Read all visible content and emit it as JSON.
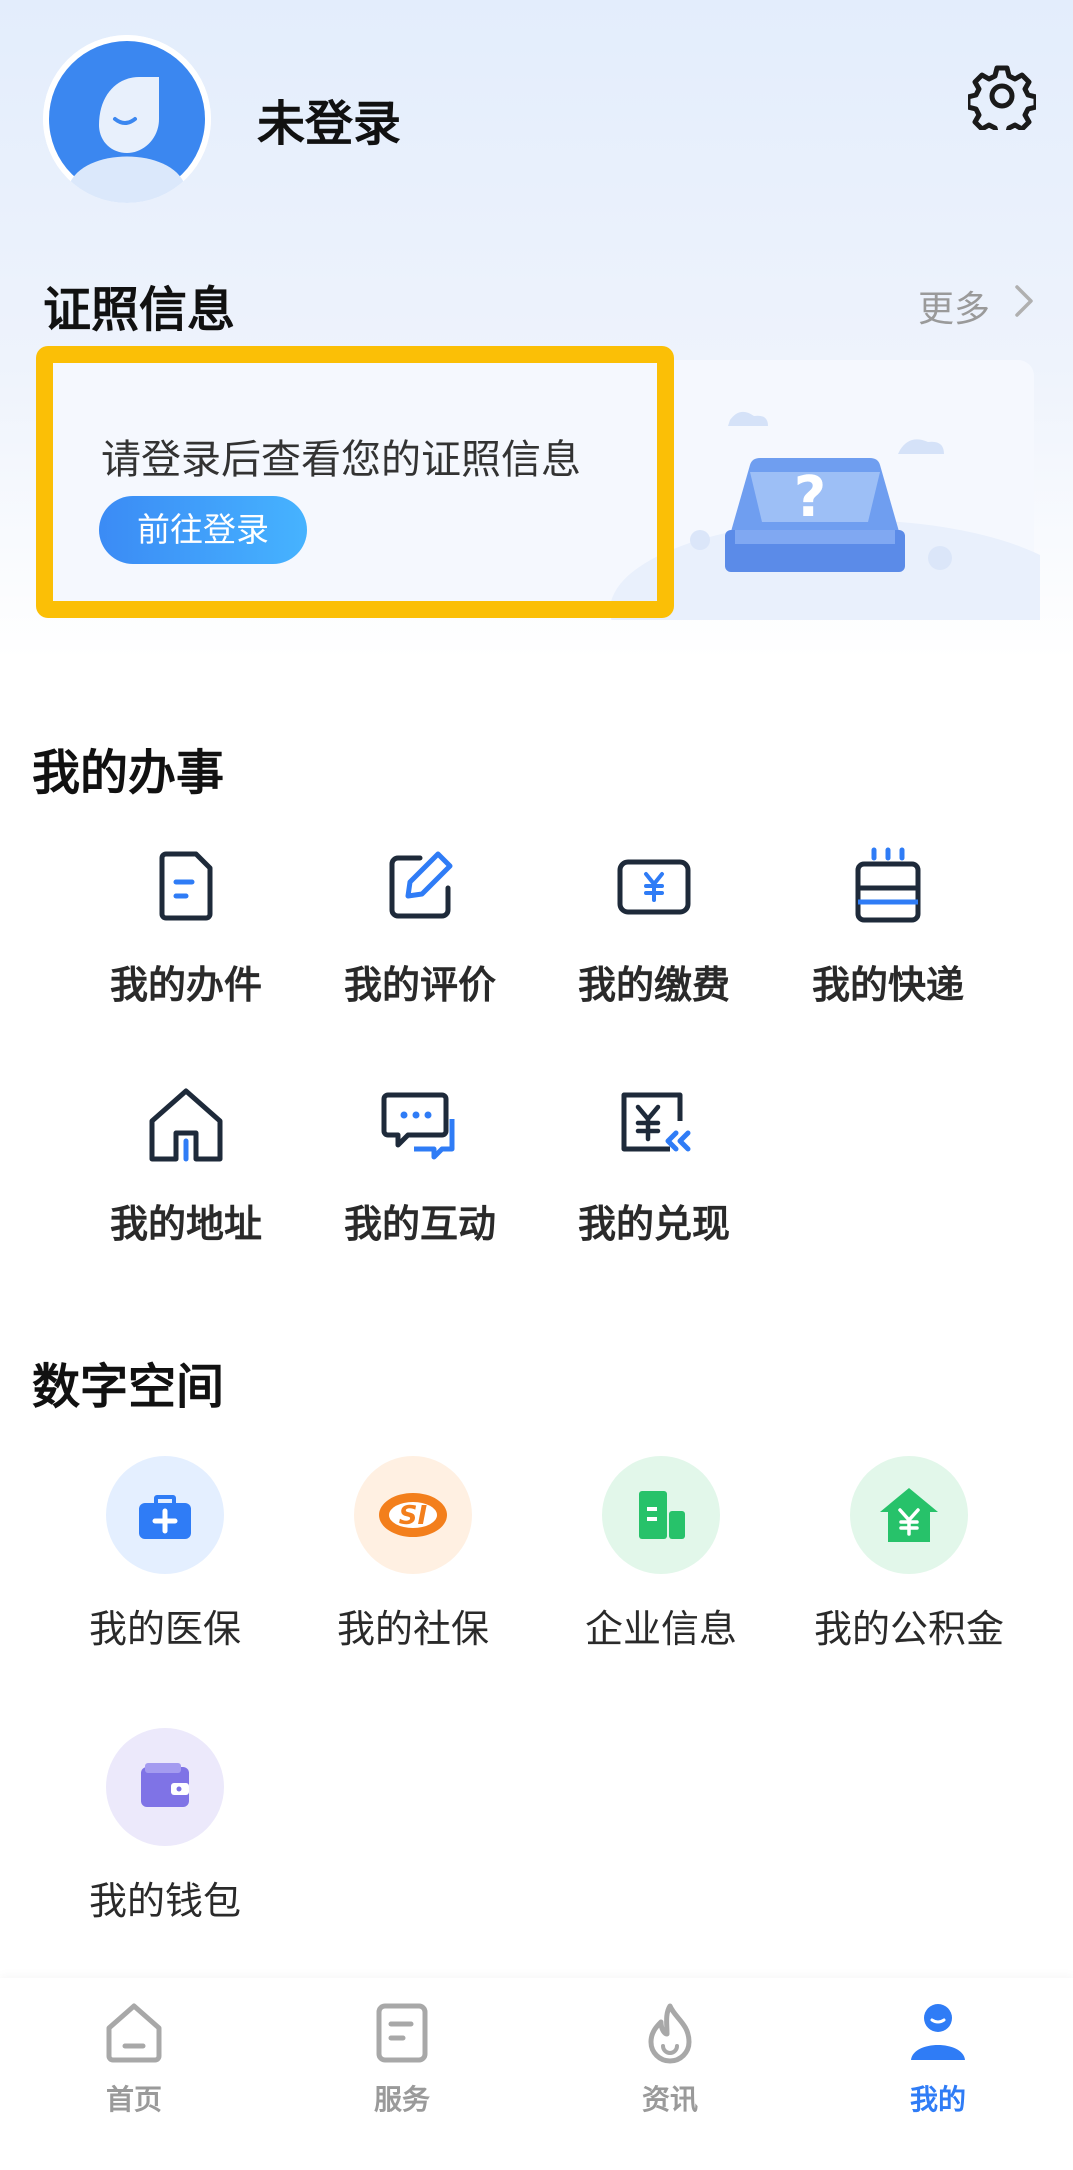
{
  "header": {
    "username": "未登录",
    "avatar_icon": "avatar-placeholder-icon",
    "settings_icon": "gear-icon"
  },
  "certificates": {
    "title": "证照信息",
    "more_label": "更多",
    "hint": "请登录后查看您的证照信息",
    "login_button": "前往登录",
    "highlight_color": "#fbbf06",
    "accent_color": "#3b8bf5"
  },
  "my_affairs": {
    "title": "我的办事",
    "items": [
      {
        "label": "我的办件",
        "icon": "document-icon"
      },
      {
        "label": "我的评价",
        "icon": "edit-icon"
      },
      {
        "label": "我的缴费",
        "icon": "yuan-payment-icon"
      },
      {
        "label": "我的快递",
        "icon": "parcel-icon"
      },
      {
        "label": "我的地址",
        "icon": "home-icon"
      },
      {
        "label": "我的互动",
        "icon": "chat-icon"
      },
      {
        "label": "我的兑现",
        "icon": "redeem-icon"
      }
    ]
  },
  "digital_space": {
    "title": "数字空间",
    "items": [
      {
        "label": "我的医保",
        "icon": "medical-kit-icon"
      },
      {
        "label": "我的社保",
        "icon": "social-security-icon"
      },
      {
        "label": "企业信息",
        "icon": "building-icon"
      },
      {
        "label": "我的公积金",
        "icon": "housing-fund-icon"
      },
      {
        "label": "我的钱包",
        "icon": "wallet-icon"
      }
    ]
  },
  "tabbar": {
    "active_color": "#2f7cf6",
    "tabs": [
      {
        "label": "首页",
        "icon": "home-tab-icon",
        "active": false
      },
      {
        "label": "服务",
        "icon": "service-tab-icon",
        "active": false
      },
      {
        "label": "资讯",
        "icon": "flame-icon",
        "active": false
      },
      {
        "label": "我的",
        "icon": "user-tab-icon",
        "active": true
      }
    ]
  }
}
